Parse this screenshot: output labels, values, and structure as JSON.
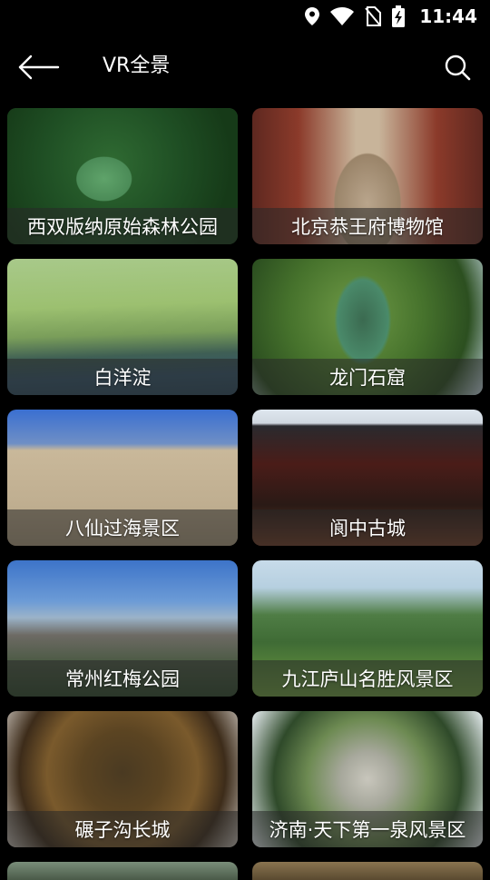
{
  "status_bar": {
    "time": "11:44"
  },
  "header": {
    "title": "VR全景"
  },
  "cards": [
    {
      "name": "西双版纳原始森林公园"
    },
    {
      "name": "北京恭王府博物馆"
    },
    {
      "name": "白洋淀"
    },
    {
      "name": "龙门石窟"
    },
    {
      "name": "八仙过海景区"
    },
    {
      "name": "阆中古城"
    },
    {
      "name": "常州红梅公园"
    },
    {
      "name": "九江庐山名胜风景区"
    },
    {
      "name": "碾子沟长城"
    },
    {
      "name": "济南·天下第一泉风景区"
    }
  ]
}
